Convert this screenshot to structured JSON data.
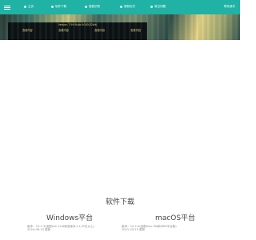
{
  "navbar": {
    "items": [
      {
        "label": "主页",
        "icon": "home-icon"
      },
      {
        "label": "软件下载",
        "icon": "download-icon"
      },
      {
        "label": "智能识别",
        "icon": "scan-icon"
      },
      {
        "label": "更新历史",
        "icon": "history-icon"
      },
      {
        "label": "常见问题",
        "icon": "question-icon"
      }
    ],
    "right": "联系我们"
  },
  "hero": {
    "caption": "Version 7.99 Build 4000(32bit)",
    "tabs": [
      "查看内容",
      "查看内容",
      "查看内容",
      "查看内容"
    ]
  },
  "download": {
    "title": "软件下载",
    "windows": {
      "title": "Windows平台",
      "version": "版本：10.1.3(适配win 10,8和旧版本,11,32位以上)",
      "updated": "2024-06-15 更新"
    },
    "mac": {
      "title": "macOS平台",
      "version": "版本：10.2.4(适配mac Mx和ARM平台版)",
      "updated": "2021-03-25 更新"
    }
  },
  "colors": {
    "navbar": "#20b2a4",
    "hero_panel": "#0d1215",
    "hero_text": "#e9d98b",
    "title_text": "#444444",
    "info_text": "#8a8a8a"
  }
}
